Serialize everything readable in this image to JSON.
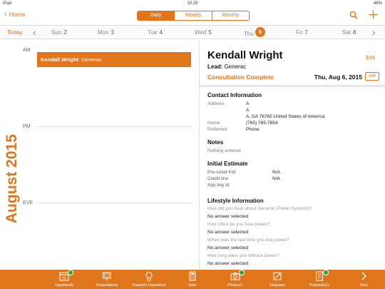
{
  "status_bar": {
    "device": "iPad",
    "time": "10:25",
    "battery": "48%"
  },
  "nav": {
    "home_label": "Home",
    "segments": [
      {
        "label": "Daily",
        "active": true
      },
      {
        "label": "Weekly",
        "active": false
      },
      {
        "label": "Monthly",
        "active": false
      }
    ],
    "icons": [
      "search-icon",
      "add-icon"
    ]
  },
  "week": {
    "today_label": "Today",
    "days": [
      {
        "name": "Sun",
        "num": "2"
      },
      {
        "name": "Mon",
        "num": "3"
      },
      {
        "name": "Tue",
        "num": "4"
      },
      {
        "name": "Wed",
        "num": "5"
      },
      {
        "name": "Thu",
        "num": "6",
        "selected": true
      },
      {
        "name": "Fri",
        "num": "7"
      },
      {
        "name": "Sat",
        "num": "8"
      }
    ]
  },
  "calendar": {
    "month_label": "August 2015",
    "am_label": "AM",
    "pm_label": "PM",
    "eve_label": "EVE",
    "event": {
      "name": "Kendall Wright",
      "company": ": Generac"
    }
  },
  "detail": {
    "name": "Kendall Wright",
    "edit_label": "Edit",
    "lead_label": "Lead:",
    "lead_value": "Generac",
    "status": "Consultation Complete",
    "date": "Thu, Aug 6, 2015",
    "ampm_badge": "AM",
    "contact": {
      "title": "Contact Information",
      "address_label": "Address",
      "address_lines": [
        "A",
        "A",
        "A, GA 76765 United States of America"
      ],
      "home_label": "Home",
      "home_value": "(765) 765-7654",
      "preferred_label": "Preferred",
      "preferred_value": "Phone"
    },
    "notes": {
      "title": "Notes",
      "value": "Nothing entered"
    },
    "estimate": {
      "title": "Initial Estimate",
      "rows": [
        {
          "label": "Pre-sized KW",
          "value": "N/A"
        },
        {
          "label": "Credit line",
          "value": "N/A"
        },
        {
          "label": "App key id",
          "value": ""
        }
      ]
    },
    "lifestyle": {
      "title": "Lifestyle Information",
      "items": [
        {
          "q": "How did you hear about Generac Power Systems?",
          "a": "No answer selected"
        },
        {
          "q": "How often do you lose power?",
          "a": "No answer selected"
        },
        {
          "q": "When was the last time you lost power?",
          "a": "No answer selected"
        },
        {
          "q": "How long were you without power?",
          "a": "No answer selected"
        }
      ]
    }
  },
  "toolbar": {
    "items": [
      {
        "label": "Opportunity",
        "icon": "calendar-icon",
        "checked": true,
        "badge": "15"
      },
      {
        "label": "Presentations",
        "icon": "presentation-icon",
        "checked": false
      },
      {
        "label": "PowerOn Experience",
        "icon": "lightbulb-icon",
        "checked": false
      },
      {
        "label": "Sizer",
        "icon": "calculator-icon",
        "checked": false
      },
      {
        "label": "Photos(1)",
        "icon": "camera-icon",
        "checked": true
      },
      {
        "label": "Diagrams",
        "icon": "diagram-icon",
        "checked": false
      },
      {
        "label": "Proposals(1)",
        "icon": "document-icon",
        "checked": true
      },
      {
        "label": "Next",
        "icon": "chevron-right-icon",
        "checked": false
      }
    ]
  },
  "colors": {
    "accent": "#e0761c",
    "check": "#2e9e3e"
  }
}
